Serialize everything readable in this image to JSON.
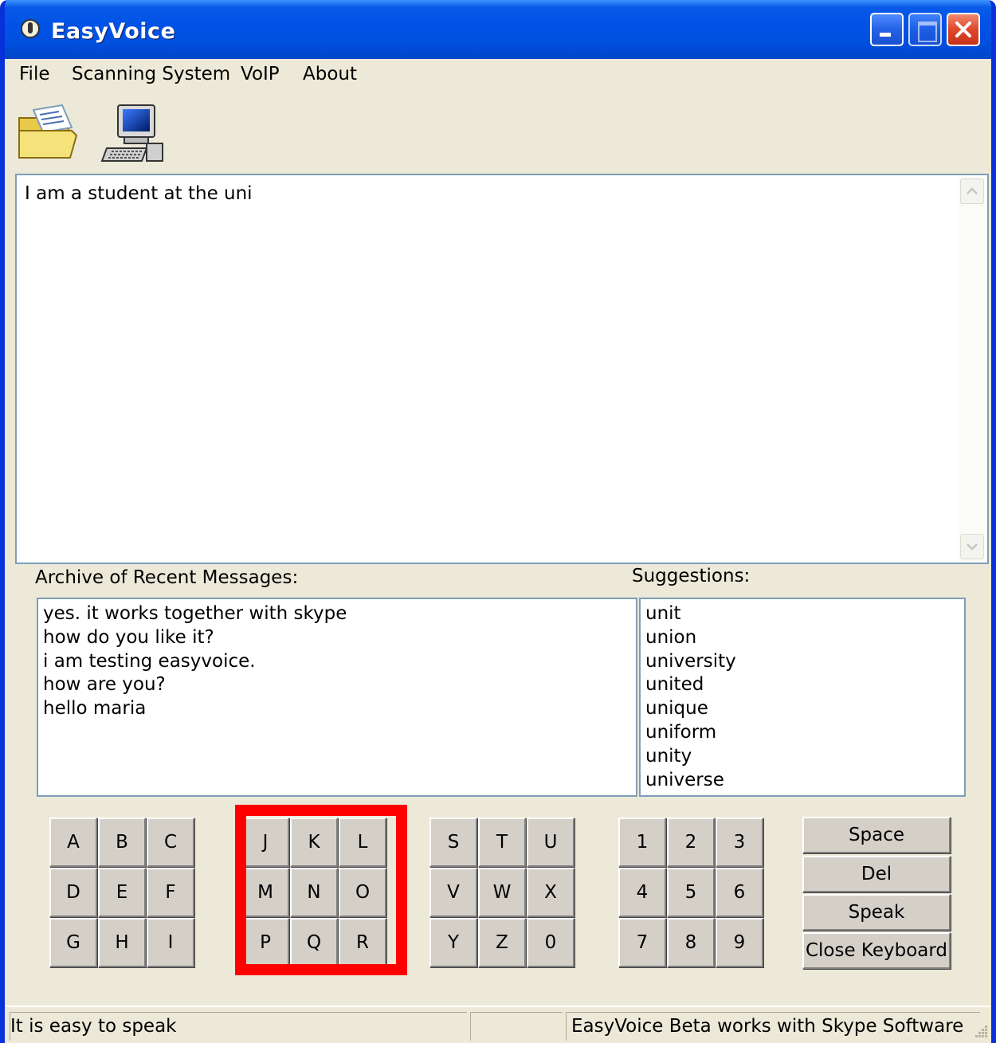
{
  "window": {
    "title": "EasyVoice"
  },
  "menu": [
    "File",
    "Scanning System",
    "VoIP",
    "About"
  ],
  "toolbar": {
    "open_icon": "open-folder-icon",
    "computer_icon": "computer-icon"
  },
  "editor": {
    "text": "I am a student at the uni"
  },
  "archive": {
    "label": "Archive of Recent Messages:",
    "items": [
      "yes. it works together with skype",
      "how do you like it?",
      "i am testing easyvoice.",
      "how are you?",
      "hello maria"
    ]
  },
  "suggestions": {
    "label": "Suggestions:",
    "items": [
      "unit",
      "union",
      "university",
      "united",
      "unique",
      "uniform",
      "unity",
      "universe"
    ]
  },
  "keyboard": {
    "group1": [
      "A",
      "B",
      "C",
      "D",
      "E",
      "F",
      "G",
      "H",
      "I"
    ],
    "group2": [
      "J",
      "K",
      "L",
      "M",
      "N",
      "O",
      "P",
      "Q",
      "R"
    ],
    "group3": [
      "S",
      "T",
      "U",
      "V",
      "W",
      "X",
      "Y",
      "Z",
      "0"
    ],
    "group4": [
      "1",
      "2",
      "3",
      "4",
      "5",
      "6",
      "7",
      "8",
      "9"
    ],
    "space": "Space",
    "del": "Del",
    "speak": "Speak",
    "close": "Close Keyboard",
    "highlight_color": "#ff0000"
  },
  "status": {
    "left": "It is easy to speak",
    "middle": "",
    "right": "EasyVoice Beta works with Skype Software"
  }
}
